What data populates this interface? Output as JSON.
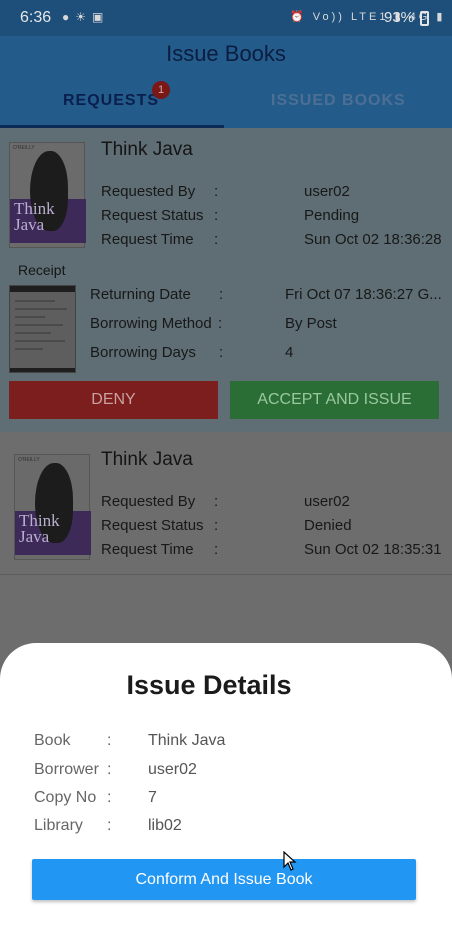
{
  "status_bar": {
    "time": "6:36",
    "net_label": "Vo)) LTE1",
    "net_label2": "4G",
    "battery": "93%",
    "icons": [
      "shield-icon",
      "weather-icon",
      "media-icon",
      "alarm-icon",
      "signal-icon",
      "signal-icon",
      "battery-icon"
    ]
  },
  "header": {
    "title": "Issue Books"
  },
  "tabs": [
    {
      "label": "REQUESTS",
      "badge": "1",
      "active": true
    },
    {
      "label": "ISSUED BOOKS",
      "active": false
    }
  ],
  "requests": [
    {
      "cover_title": "Think Java",
      "title": "Think Java",
      "fields": [
        {
          "label": "Requested  By",
          "value": "user02"
        },
        {
          "label": "Request Status",
          "value": "Pending"
        },
        {
          "label": "Request  Time",
          "value": "Sun Oct 02 18:36:28"
        }
      ],
      "receipt_label": "Receipt",
      "receipt_fields": [
        {
          "label": "Returning  Date",
          "value": "Fri Oct 07 18:36:27 G..."
        },
        {
          "label": "Borrowing Method",
          "value": "By Post"
        },
        {
          "label": "Borrowing Days",
          "value": "4"
        }
      ],
      "deny_label": "DENY",
      "accept_label": "ACCEPT AND ISSUE"
    },
    {
      "cover_title": "Think Java",
      "title": "Think Java",
      "fields": [
        {
          "label": "Requested  By",
          "value": "user02"
        },
        {
          "label": "Request Status",
          "value": "Denied"
        },
        {
          "label": "Request  Time",
          "value": "Sun Oct 02 18:35:31"
        }
      ]
    }
  ],
  "sheet": {
    "title": "Issue Details",
    "details": [
      {
        "label": "Book",
        "value": "Think Java"
      },
      {
        "label": "Borrower",
        "value": "user02"
      },
      {
        "label": "Copy No",
        "value": "7"
      },
      {
        "label": "Library",
        "value": "lib02"
      }
    ],
    "button_label": "Conform And Issue Book"
  },
  "colors": {
    "primary": "#2196f3",
    "deny": "#e53935",
    "accept": "#43a047",
    "badge": "#f44336"
  }
}
